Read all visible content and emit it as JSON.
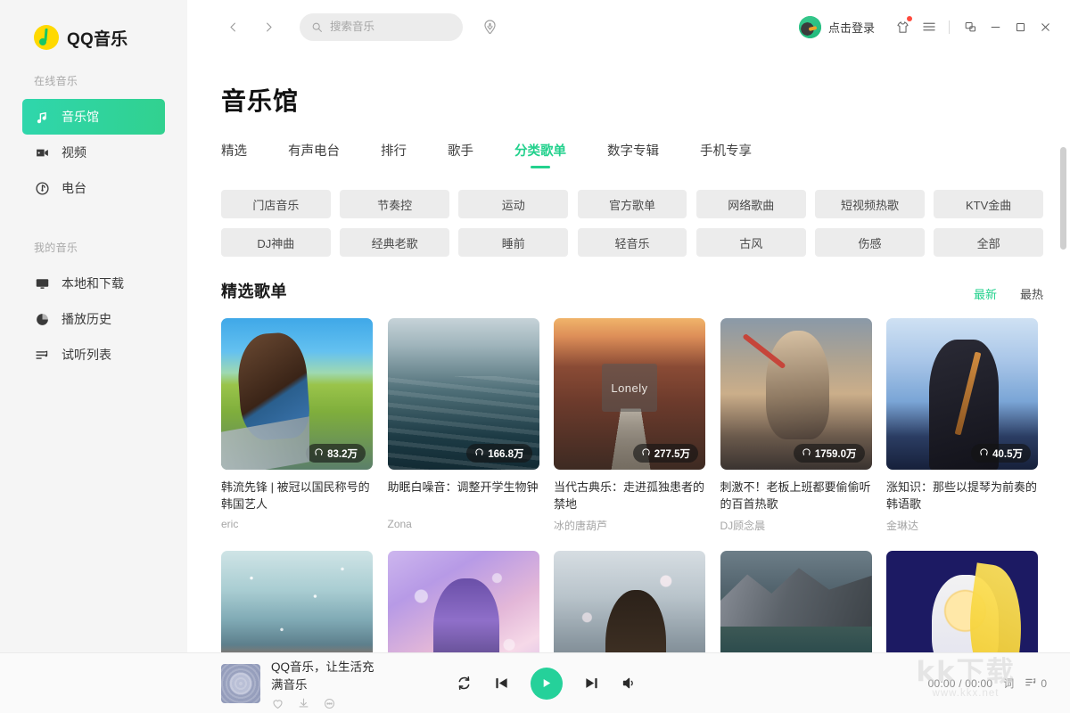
{
  "app": {
    "brand": "QQ音乐",
    "logo_icon": "qq-music-note-icon"
  },
  "sidebar": {
    "groups": [
      {
        "title": "在线音乐",
        "items": [
          {
            "label": "音乐馆",
            "icon": "music-note-icon",
            "active": true
          },
          {
            "label": "视频",
            "icon": "video-camera-icon",
            "active": false
          },
          {
            "label": "电台",
            "icon": "radio-icon",
            "active": false
          }
        ]
      },
      {
        "title": "我的音乐",
        "items": [
          {
            "label": "本地和下载",
            "icon": "monitor-icon",
            "active": false
          },
          {
            "label": "播放历史",
            "icon": "clock-icon",
            "active": false
          },
          {
            "label": "试听列表",
            "icon": "playlist-icon",
            "active": false
          }
        ]
      }
    ]
  },
  "titlebar": {
    "back_icon": "chevron-left-icon",
    "forward_icon": "chevron-right-icon",
    "search_placeholder": "搜索音乐",
    "search_value": "",
    "search_icon": "search-icon",
    "voice_icon": "microphone-icon",
    "login_label": "点击登录",
    "avatar_icon": "user-avatar",
    "skin_icon": "t-shirt-icon",
    "menu_icon": "hamburger-menu-icon",
    "mini_icon": "mini-mode-icon",
    "minimize_icon": "minimize-icon",
    "maximize_icon": "maximize-icon",
    "close_icon": "close-icon"
  },
  "page": {
    "title": "音乐馆",
    "tabs": [
      {
        "label": "精选",
        "active": false
      },
      {
        "label": "有声电台",
        "active": false
      },
      {
        "label": "排行",
        "active": false
      },
      {
        "label": "歌手",
        "active": false
      },
      {
        "label": "分类歌单",
        "active": true
      },
      {
        "label": "数字专辑",
        "active": false
      },
      {
        "label": "手机专享",
        "active": false
      }
    ],
    "category_rows": [
      [
        "门店音乐",
        "节奏控",
        "运动",
        "官方歌单",
        "网络歌曲",
        "短视频热歌",
        "KTV金曲"
      ],
      [
        "DJ神曲",
        "经典老歌",
        "睡前",
        "轻音乐",
        "古风",
        "伤感",
        "全部"
      ]
    ],
    "section": {
      "title": "精选歌单",
      "sorts": [
        {
          "label": "最新",
          "active": true
        },
        {
          "label": "最热",
          "active": false
        }
      ]
    },
    "playlists": [
      {
        "title": "韩流先锋 | 被冠以国民称号的韩国艺人",
        "author": "eric",
        "plays": "83.2万",
        "cover": "cv1"
      },
      {
        "title": "助眠白噪音：调整开学生物钟",
        "author": "Zona",
        "plays": "166.8万",
        "cover": "cv2"
      },
      {
        "title": "当代古典乐：走进孤独患者的禁地",
        "author": "冰的唐葫芦",
        "plays": "277.5万",
        "cover": "cv3",
        "cover_text": "Lonely"
      },
      {
        "title": "刺激不！老板上班都要偷偷听的百首热歌",
        "author": "DJ顾念晨",
        "plays": "1759.0万",
        "cover": "cv4"
      },
      {
        "title": "涨知识：那些以提琴为前奏的韩语歌",
        "author": "金琳达",
        "plays": "40.5万",
        "cover": "cv5"
      }
    ],
    "playlists_row2": [
      {
        "cover": "cv6"
      },
      {
        "cover": "cv7"
      },
      {
        "cover": "cv8"
      },
      {
        "cover": "cv9"
      },
      {
        "cover": "cv10"
      }
    ],
    "headphone_icon": "headphone-icon"
  },
  "player": {
    "track_title": "QQ音乐，让生活充满音乐",
    "cover_icon": "album-cover",
    "like_icon": "heart-icon",
    "download_icon": "download-icon",
    "more_icon": "more-dots-icon",
    "repeat_icon": "repeat-icon",
    "prev_icon": "previous-track-icon",
    "play_icon": "play-icon",
    "next_icon": "next-track-icon",
    "volume_icon": "volume-icon",
    "time": "00:00 / 00:00",
    "lyrics_label": "词",
    "queue_icon": "queue-list-icon",
    "queue_count": "0"
  },
  "watermark": {
    "big": "kk下载",
    "small": "www.kkx.net"
  },
  "colors": {
    "accent": "#23d18d",
    "accent_gradient_start": "#2fd6ac",
    "accent_gradient_end": "#31d18f",
    "sidebar_bg": "#f5f5f5",
    "chip_bg": "#ececec",
    "notification_dot": "#ff4a3d",
    "logo_yellow": "#ffd900"
  }
}
